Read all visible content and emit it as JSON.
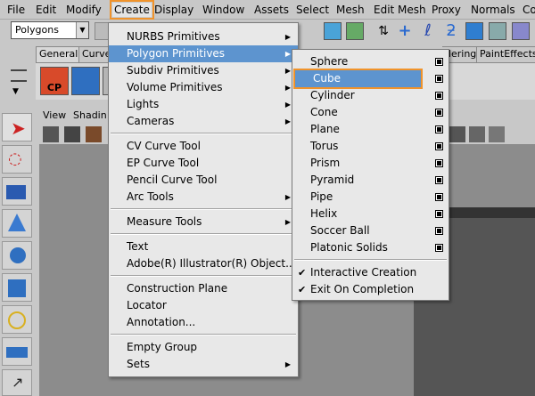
{
  "menubar": {
    "items": [
      "File",
      "Edit",
      "Modify",
      "Create",
      "Display",
      "Window",
      "Assets",
      "Select",
      "Mesh",
      "Edit Mesh",
      "Proxy",
      "Normals",
      "Colo"
    ],
    "active": "Create"
  },
  "mode_select": {
    "value": "Polygons"
  },
  "shelf": {
    "tabs": [
      "General",
      "Curve",
      "dering",
      "PaintEffects"
    ],
    "cp_label": "CP"
  },
  "viewport": {
    "menu": [
      "View",
      "Shadin"
    ]
  },
  "create_menu": {
    "items": [
      {
        "label": "NURBS Primitives",
        "sub": true
      },
      {
        "label": "Polygon Primitives",
        "sub": true,
        "highlight": true
      },
      {
        "label": "Subdiv Primitives",
        "sub": true
      },
      {
        "label": "Volume Primitives",
        "sub": true
      },
      {
        "label": "Lights",
        "sub": true
      },
      {
        "label": "Cameras",
        "sub": true
      },
      {
        "sep": true
      },
      {
        "label": "CV Curve Tool"
      },
      {
        "label": "EP Curve Tool"
      },
      {
        "label": "Pencil Curve Tool"
      },
      {
        "label": "Arc Tools",
        "sub": true
      },
      {
        "sep": true
      },
      {
        "label": "Measure Tools",
        "sub": true
      },
      {
        "sep": true
      },
      {
        "label": "Text"
      },
      {
        "label": "Adobe(R) Illustrator(R) Object..."
      },
      {
        "sep": true
      },
      {
        "label": "Construction Plane"
      },
      {
        "label": "Locator"
      },
      {
        "label": "Annotation..."
      },
      {
        "sep": true
      },
      {
        "label": "Empty Group"
      },
      {
        "label": "Sets",
        "sub": true
      }
    ]
  },
  "polygon_menu": {
    "items": [
      {
        "label": "Sphere",
        "opt": true
      },
      {
        "label": "Cube",
        "opt": true,
        "highlight": true
      },
      {
        "label": "Cylinder",
        "opt": true
      },
      {
        "label": "Cone",
        "opt": true
      },
      {
        "label": "Plane",
        "opt": true
      },
      {
        "label": "Torus",
        "opt": true
      },
      {
        "label": "Prism",
        "opt": true
      },
      {
        "label": "Pyramid",
        "opt": true
      },
      {
        "label": "Pipe",
        "opt": true
      },
      {
        "label": "Helix",
        "opt": true
      },
      {
        "label": "Soccer Ball",
        "opt": true
      },
      {
        "label": "Platonic Solids",
        "opt": true
      },
      {
        "sep": true
      },
      {
        "label": "Interactive Creation",
        "checked": true
      },
      {
        "label": "Exit On Completion",
        "checked": true
      }
    ]
  },
  "colors": {
    "highlight": "#5d94cf",
    "accent": "#f0932b"
  }
}
